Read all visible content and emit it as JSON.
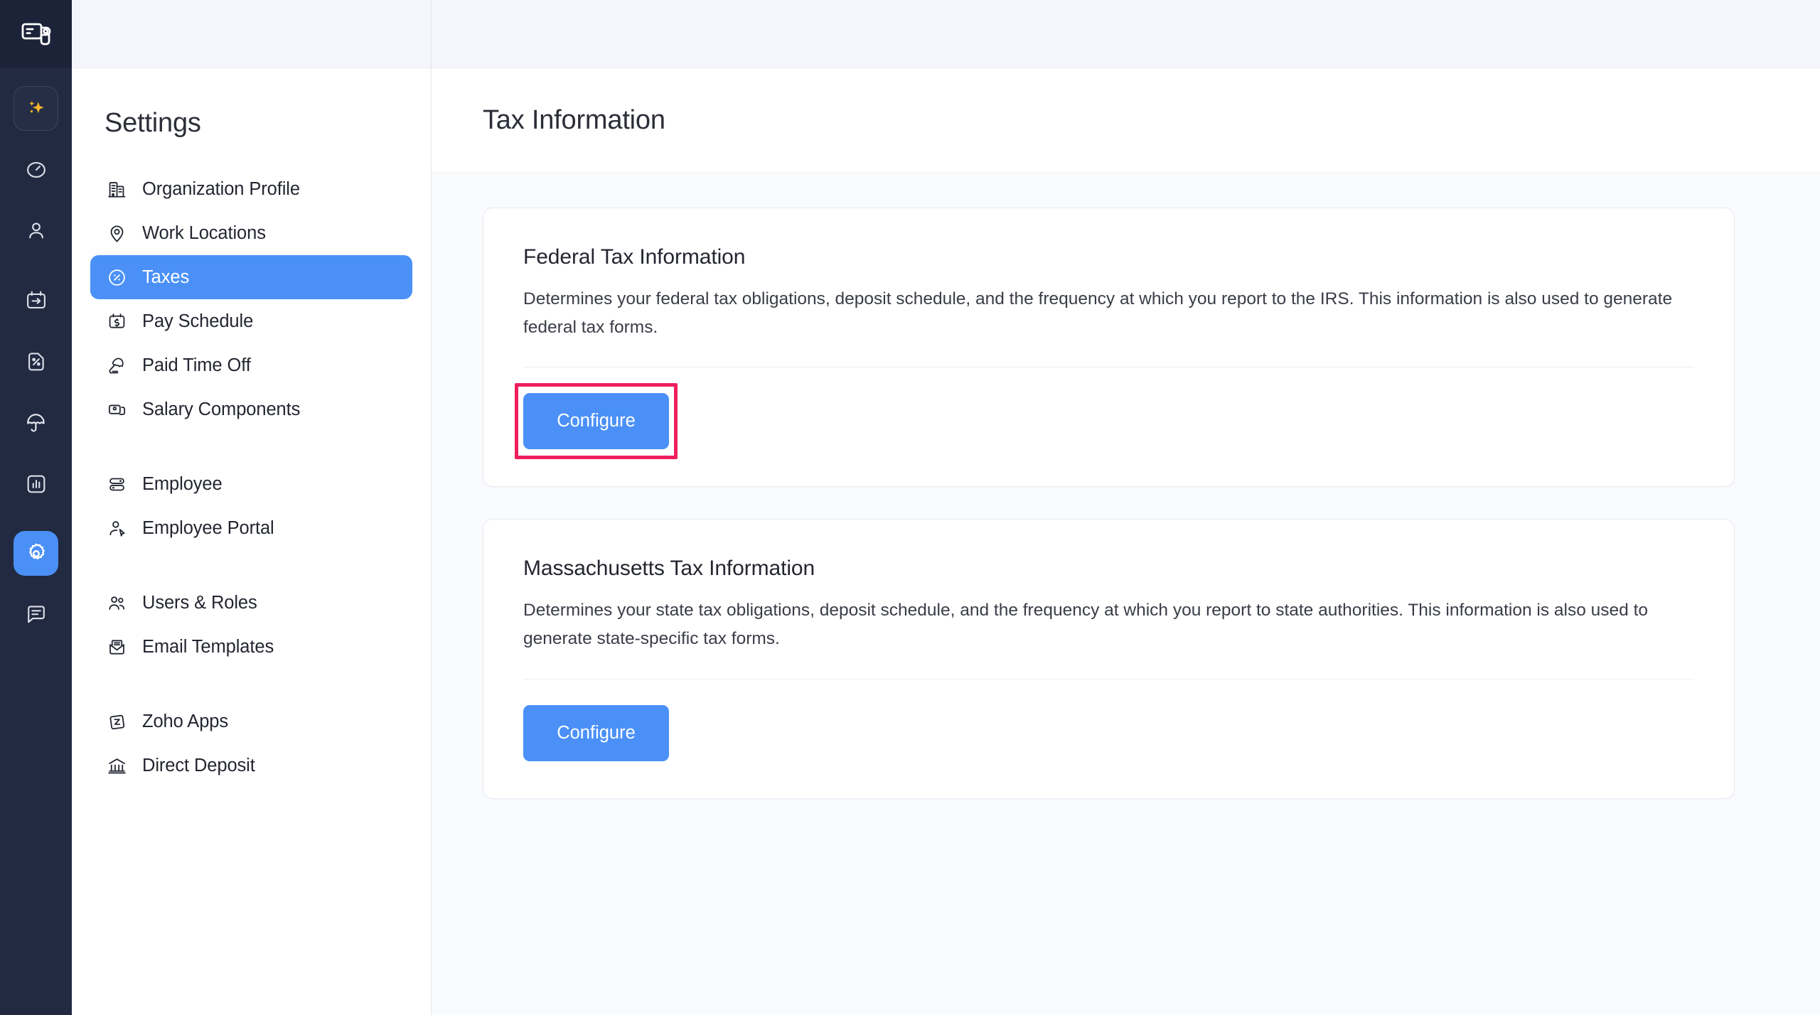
{
  "app": {
    "logo_icon": "payroll-logo-icon"
  },
  "rail": {
    "items": [
      {
        "icon": "sparkle-ai-icon",
        "name": "ai-assistant",
        "state": "boxed"
      },
      {
        "icon": "dashboard-speedometer-icon",
        "name": "dashboard",
        "state": "normal"
      },
      {
        "icon": "employee-person-icon",
        "name": "employees",
        "state": "normal"
      },
      {
        "icon": "pay-runs-calendar-arrow-icon",
        "name": "pay-runs",
        "state": "normal"
      },
      {
        "icon": "taxes-percent-document-icon",
        "name": "taxes",
        "state": "normal"
      },
      {
        "icon": "time-off-umbrella-icon",
        "name": "time-off",
        "state": "normal"
      },
      {
        "icon": "reports-bar-chart-icon",
        "name": "reports",
        "state": "normal"
      },
      {
        "icon": "settings-gear-icon",
        "name": "settings",
        "state": "active"
      },
      {
        "icon": "chat-message-icon",
        "name": "chat",
        "state": "normal"
      }
    ]
  },
  "sidebar": {
    "title": "Settings",
    "groups": [
      {
        "items": [
          {
            "label": "Organization Profile",
            "icon": "organization-building-icon",
            "active": false
          },
          {
            "label": "Work Locations",
            "icon": "map-pin-icon",
            "active": false
          },
          {
            "label": "Taxes",
            "icon": "percent-circle-icon",
            "active": true
          },
          {
            "label": "Pay Schedule",
            "icon": "calendar-dollar-icon",
            "active": false
          },
          {
            "label": "Paid Time Off",
            "icon": "beach-umbrella-chair-icon",
            "active": false
          },
          {
            "label": "Salary Components",
            "icon": "stacked-cards-icon",
            "active": false
          }
        ]
      },
      {
        "items": [
          {
            "label": "Employee",
            "icon": "toggle-list-icon",
            "active": false
          },
          {
            "label": "Employee Portal",
            "icon": "person-cursor-icon",
            "active": false
          }
        ]
      },
      {
        "items": [
          {
            "label": "Users & Roles",
            "icon": "two-people-icon",
            "active": false
          },
          {
            "label": "Email Templates",
            "icon": "envelope-icon",
            "active": false
          }
        ]
      },
      {
        "items": [
          {
            "label": "Zoho Apps",
            "icon": "zoho-z-icon",
            "active": false
          },
          {
            "label": "Direct Deposit",
            "icon": "bank-building-icon",
            "active": false
          }
        ]
      }
    ]
  },
  "main": {
    "page_title": "Tax Information",
    "cards": [
      {
        "title": "Federal Tax Information",
        "description": "Determines your federal tax obligations, deposit schedule, and the frequency at which you report to the IRS. This information is also used to generate federal tax forms.",
        "button_label": "Configure",
        "highlighted": true
      },
      {
        "title": "Massachusetts Tax Information",
        "description": "Determines your state tax obligations, deposit schedule, and the frequency at which you report to state authorities. This information is also used to generate state-specific tax forms.",
        "button_label": "Configure",
        "highlighted": false
      }
    ]
  },
  "colors": {
    "accent_blue": "#4a90f7",
    "rail_dark": "#222a41",
    "highlight_pink": "#ef1f5e",
    "top_strip": "#f5f6fb",
    "content_bg": "#fafbfd"
  }
}
